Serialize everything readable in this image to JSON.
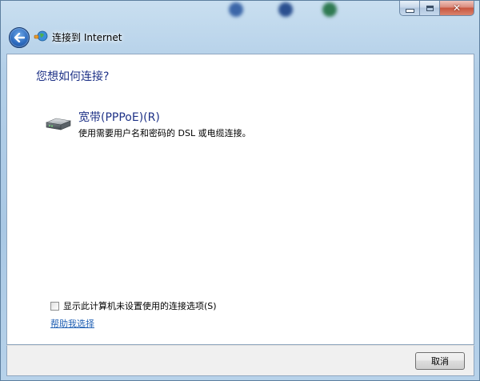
{
  "window": {
    "title": "连接到 Internet"
  },
  "caption_buttons": {
    "minimize_icon": "minimize-icon",
    "maximize_icon": "maximize-icon",
    "close_glyph": "✕"
  },
  "main": {
    "heading": "您想如何连接?",
    "option": {
      "title": "宽带(PPPoE)(R)",
      "description": "使用需要用户名和密码的 DSL 或电缆连接。",
      "icon": "broadband-modem-icon"
    },
    "show_options_checkbox": {
      "label": "显示此计算机未设置使用的连接选项(S)",
      "checked": false
    },
    "help_link": "帮助我选择"
  },
  "footer": {
    "cancel_label": "取消"
  },
  "colors": {
    "heading_blue": "#1e3287",
    "link_blue": "#1f5fb3",
    "glass": "#b3cfe8"
  }
}
